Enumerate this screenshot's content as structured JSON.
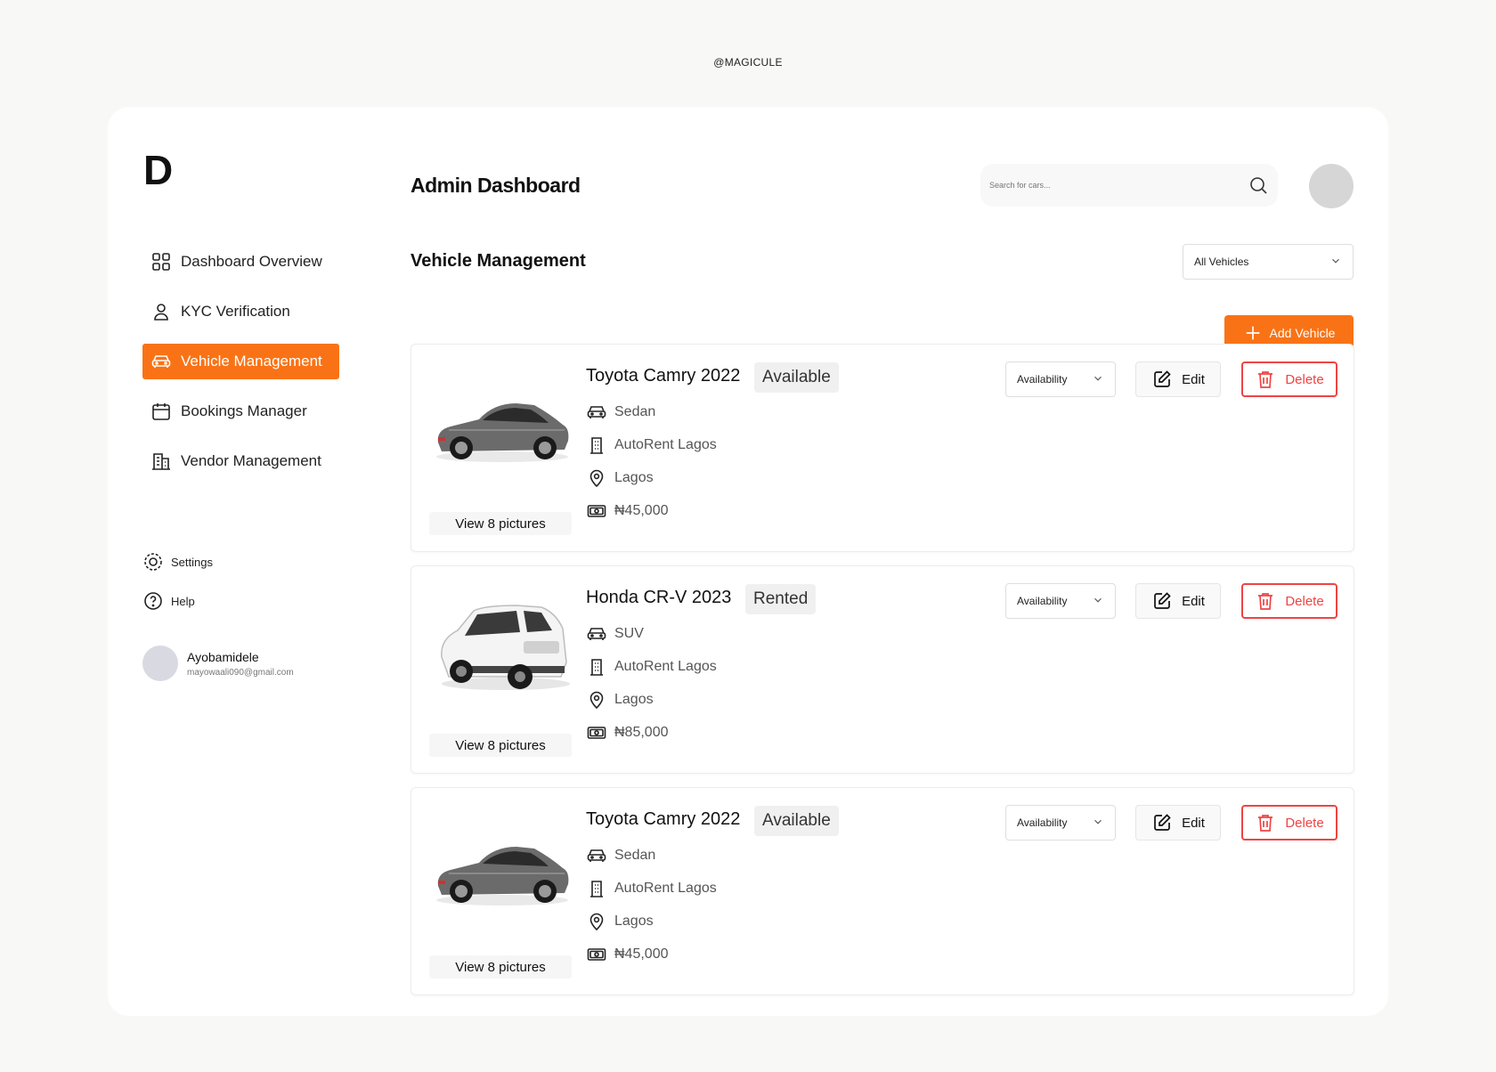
{
  "watermark": "@MAGICULE",
  "logo": "D",
  "header": {
    "title": "Admin Dashboard",
    "search_placeholder": "Search for cars..."
  },
  "sidebar": {
    "items": [
      {
        "label": "Dashboard Overview",
        "icon": "grid-icon"
      },
      {
        "label": "KYC Verification",
        "icon": "user-icon"
      },
      {
        "label": "Vehicle Management",
        "icon": "car-icon",
        "active": true
      },
      {
        "label": "Bookings Manager",
        "icon": "calendar-icon"
      },
      {
        "label": "Vendor Management",
        "icon": "building-icon"
      }
    ],
    "secondary": [
      {
        "label": "Settings",
        "icon": "gear-icon"
      },
      {
        "label": "Help",
        "icon": "help-circle-icon"
      }
    ],
    "user": {
      "name": "Ayobamidele",
      "email": "mayowaali090@gmail.com"
    }
  },
  "main": {
    "section_title": "Vehicle Management",
    "filter": "All Vehicles",
    "add_label": "Add Vehicle"
  },
  "vehicles": [
    {
      "name": "Toyota Camry 2022",
      "status": "Available",
      "type": "Sedan",
      "vendor": "AutoRent Lagos",
      "location": "Lagos",
      "price": "₦45,000",
      "pictures": "View 8 pictures",
      "availability": "Availability",
      "edit": "Edit",
      "delete": "Delete",
      "photo": "sedan"
    },
    {
      "name": "Honda CR-V 2023",
      "status": "Rented",
      "type": "SUV",
      "vendor": "AutoRent Lagos",
      "location": "Lagos",
      "price": "₦85,000",
      "pictures": "View 8 pictures",
      "availability": "Availability",
      "edit": "Edit",
      "delete": "Delete",
      "photo": "suv"
    },
    {
      "name": "Toyota Camry 2022",
      "status": "Available",
      "type": "Sedan",
      "vendor": "AutoRent Lagos",
      "location": "Lagos",
      "price": "₦45,000",
      "pictures": "View 8 pictures",
      "availability": "Availability",
      "edit": "Edit",
      "delete": "Delete",
      "photo": "sedan"
    }
  ],
  "colors": {
    "accent": "#f97316",
    "danger": "#ef4444"
  }
}
